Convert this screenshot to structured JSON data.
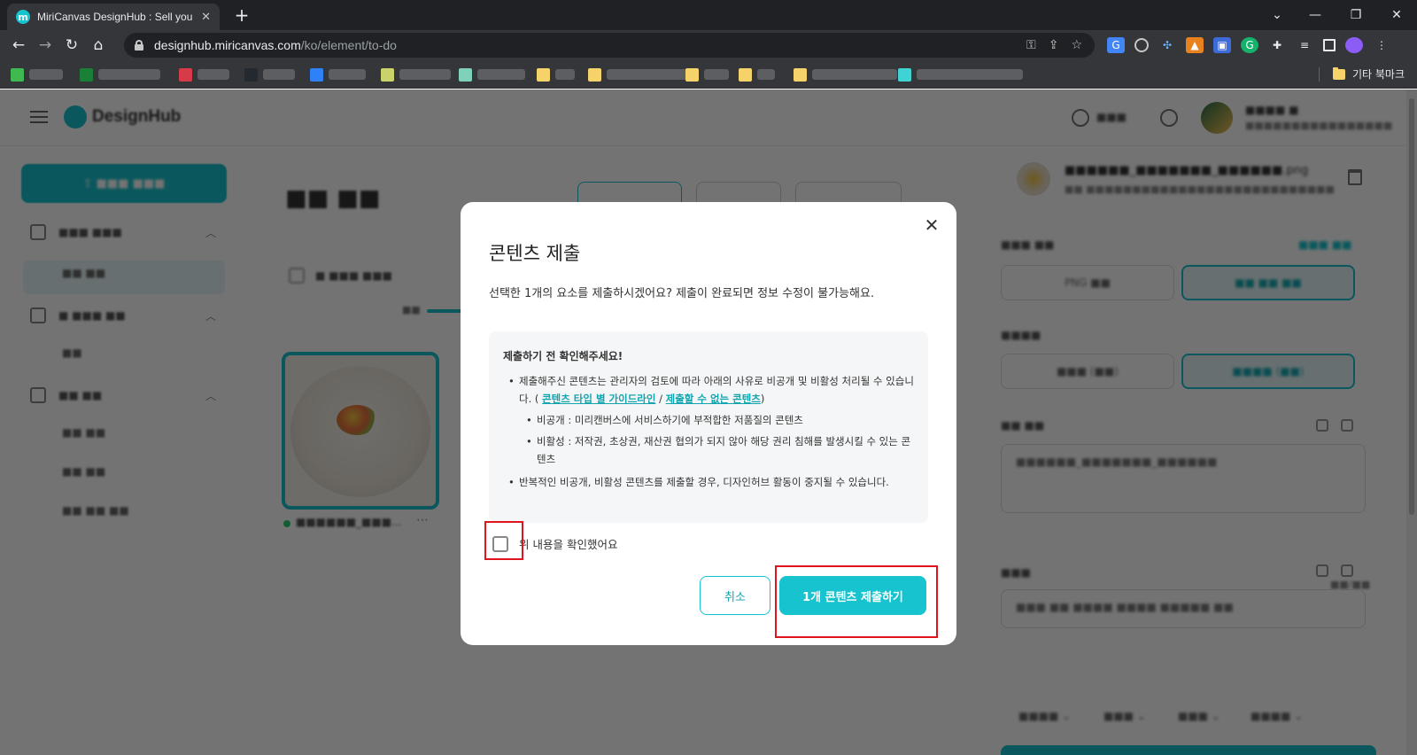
{
  "browser": {
    "tab_title": "MiriCanvas DesignHub : Sell you",
    "tab_favicon_letter": "m",
    "url_host": "designhub.miricanvas.com",
    "url_path": "/ko/element/to-do",
    "other_bookmarks_label": "기타 북마크"
  },
  "modal": {
    "title": "콘텐츠 제출",
    "description": "선택한 1개의 요소를 제출하시겠어요? 제출이 완료되면 정보 수정이 불가능해요.",
    "notice": {
      "heading": "제출하기 전 확인해주세요!",
      "item1_text": "제출해주신 콘텐츠는 관리자의 검토에 따라 아래의 사유로 비공개 및 비활성 처리될 수 있습니다. (",
      "item1_link1": "콘텐츠 타입 별 가이드라인",
      "item1_sep": " / ",
      "item1_link2": "제출할 수 없는 콘텐츠",
      "item1_close": ")",
      "sub1": "비공개 : 미리캔버스에 서비스하기에 부적합한 저품질의 콘텐츠",
      "sub2": "비활성 : 저작권, 초상권, 재산권 협의가 되지 않아 해당 권리 침해를 발생시킬 수 있는 콘텐츠",
      "item2_text": "반복적인 비공개, 비활성 콘텐츠를 제출할 경우, 디자인허브 활동이 중지될 수 있습니다."
    },
    "confirm_label": "위 내용을 확인했어요",
    "cancel_label": "취소",
    "submit_label": "1개 콘텐츠 제출하기"
  },
  "colors": {
    "accent": "#17c3ce",
    "highlight": "#e0141c"
  }
}
